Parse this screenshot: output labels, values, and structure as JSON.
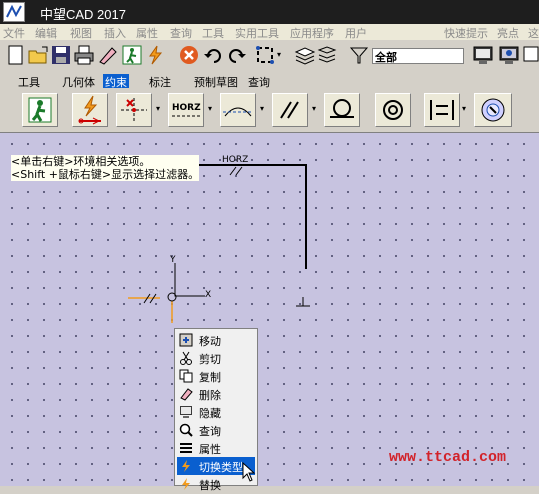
{
  "title": "中望CAD 2017",
  "menu": [
    "文件",
    "编辑",
    "视图",
    "插入",
    "属性",
    "查询",
    "工具",
    "实用工具",
    "应用程序",
    "用户",
    "快速提示",
    "亮点",
    "这"
  ],
  "toolbar": {
    "layer_select": "全部"
  },
  "tabs": [
    "工具",
    "几何体",
    "约束",
    "标注",
    "预制草图",
    "查询"
  ],
  "active_tab_index": 2,
  "ribbon": {
    "horz_label": "HORZ"
  },
  "canvas": {
    "dim_label": "HORZ",
    "axis_x": "X",
    "axis_y": "Y"
  },
  "tooltip": {
    "line1": "<单击右键>环境相关选项。",
    "line2": "<Shift +鼠标右键>显示选择过滤器。"
  },
  "context_menu": {
    "items": [
      "移动",
      "剪切",
      "复制",
      "删除",
      "隐藏",
      "查询",
      "属性",
      "切换类型",
      "替换"
    ],
    "selected_index": 7
  },
  "watermark": "www.ttcad.com",
  "colors": {
    "accent": "#0a5fcf",
    "canvas_bg": "#c7c3e0",
    "watermark": "#d2232a"
  }
}
